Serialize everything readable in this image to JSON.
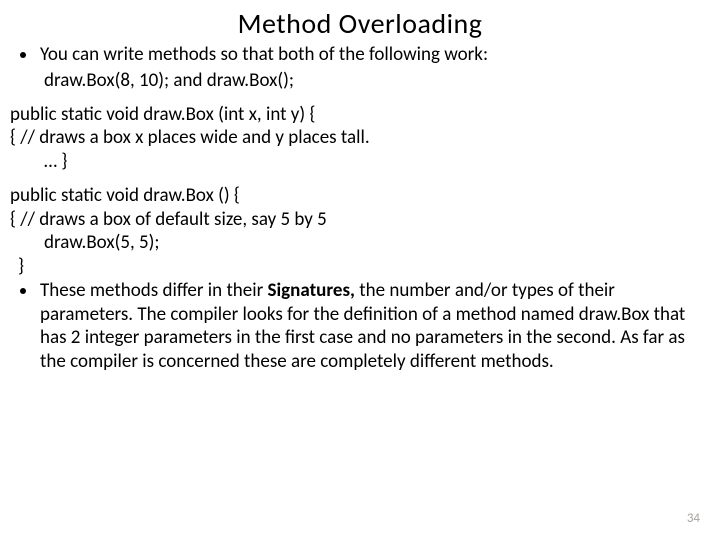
{
  "title": "Method  Overloading",
  "bullet1": "You can write methods so that both of the following work:",
  "bullet1_line2": "draw.Box(8, 10);   and  draw.Box();",
  "code1_line1": "public static void draw.Box (int x, int y) {",
  "code1_line2": "{  // draws a box x places wide and y places tall.",
  "code1_line3": "… }",
  "code2_line1": "public static void draw.Box () {",
  "code2_line2": "{ // draws a box of default size, say 5 by 5",
  "code2_line3": "draw.Box(5, 5);",
  "code2_line4": " }",
  "bullet2_pre": "These methods differ in their ",
  "bullet2_bold": "Signatures, ",
  "bullet2_post": "the number and/or types of their parameters.   The compiler looks for the definition of a method named draw.Box that has 2 integer parameters in the first case and no parameters in the second.  As far as the compiler is concerned these are completely different methods.",
  "page_number": "34"
}
